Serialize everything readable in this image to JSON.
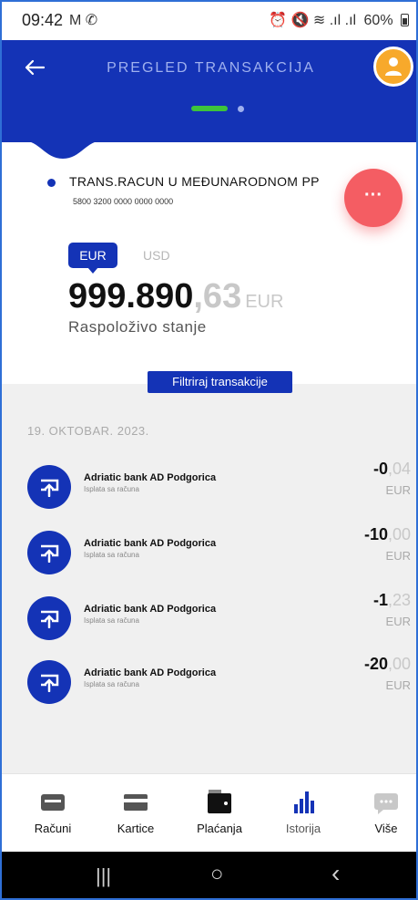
{
  "status_bar": {
    "time": "09:42",
    "left_icons": "M ✆",
    "right_icons": "⏰ 🔇 ≋ .ıl .ıl",
    "battery": "60%"
  },
  "header": {
    "title": "PREGLED TRANSAKCIJA",
    "back_icon": "arrow-left-icon",
    "avatar_icon": "user-icon",
    "avatar_color": "#f7a92b",
    "pager_active_color": "#3ec43b"
  },
  "account": {
    "name": "TRANS.RACUN U MEĐUNARODNOM PP",
    "number": "5800 3200 0000 0000 0000",
    "more_label": "···",
    "currencies": [
      "EUR",
      "USD"
    ],
    "balance_main": "999.890",
    "balance_decimal": ",63",
    "balance_currency": "EUR",
    "balance_label": "Raspoloživo stanje"
  },
  "filter_button": "Filtriraj transakcije",
  "transactions": {
    "date": "19. OKTOBAR. 2023.",
    "items": [
      {
        "title": "Adriatic bank AD Podgorica",
        "subtitle": "Isplata sa računa",
        "amount_main": "-0",
        "amount_decimal": ",04",
        "currency": "EUR"
      },
      {
        "title": "Adriatic bank AD Podgorica",
        "subtitle": "Isplata sa računa",
        "amount_main": "-10",
        "amount_decimal": ",00",
        "currency": "EUR"
      },
      {
        "title": "Adriatic bank AD Podgorica",
        "subtitle": "Isplata sa računa",
        "amount_main": "-1",
        "amount_decimal": ",23",
        "currency": "EUR"
      },
      {
        "title": "Adriatic bank AD Podgorica",
        "subtitle": "Isplata sa računa",
        "amount_main": "-20",
        "amount_decimal": ",00",
        "currency": "EUR"
      }
    ]
  },
  "bottom_nav": {
    "items": [
      {
        "label": "Računi",
        "icon": "accounts-icon"
      },
      {
        "label": "Kartice",
        "icon": "card-icon"
      },
      {
        "label": "Plaćanja",
        "icon": "wallet-icon"
      },
      {
        "label": "Istorija",
        "icon": "bar-chart-icon"
      },
      {
        "label": "Više",
        "icon": "more-chat-icon"
      }
    ],
    "active": "Istorija"
  },
  "system_nav": {
    "recents": "|||",
    "home": "○",
    "back": "‹"
  },
  "colors": {
    "primary": "#1433b6",
    "accent_red": "#f45d63",
    "muted": "#c8c8c8"
  }
}
